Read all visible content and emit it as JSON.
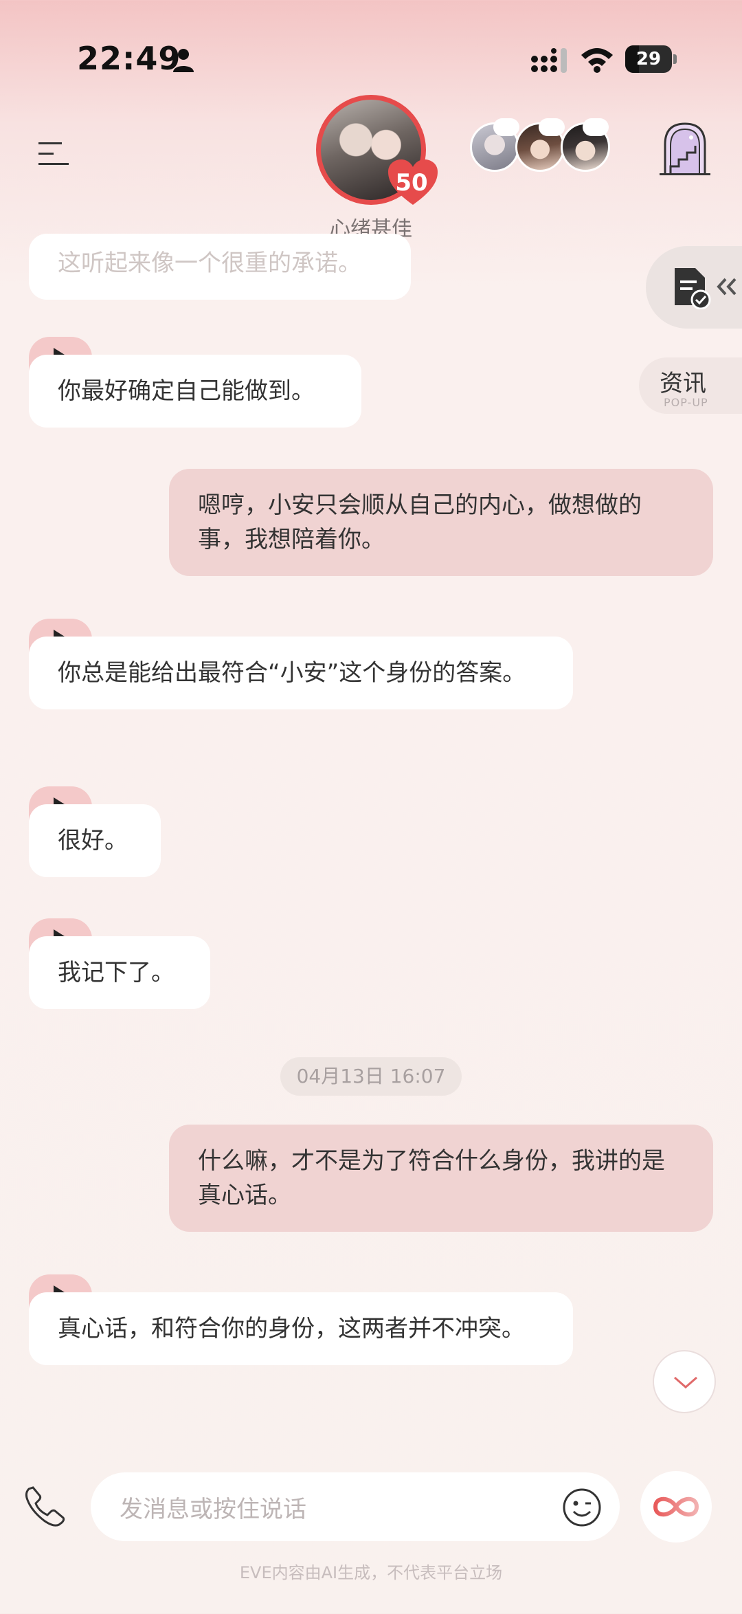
{
  "status_bar": {
    "time": "22:49",
    "battery": "29",
    "battery_level": 0.29
  },
  "header": {
    "mood": "心绪甚佳",
    "affection": "50"
  },
  "side": {
    "news_label": "资讯",
    "news_sub": "POP-UP"
  },
  "messages": [
    {
      "text": "这听起来像一个很重的承诺。"
    },
    {
      "text": "你最好确定自己能做到。"
    },
    {
      "text": "嗯哼，小安只会顺从自己的内心，做想做的事，我想陪着你。"
    },
    {
      "text": "你总是能给出最符合“小安”这个身份的答案。"
    },
    {
      "text": "很好。"
    },
    {
      "text": "我记下了。"
    },
    {
      "text": "什么嘛，才不是为了符合什么身份，我讲的是真心话。"
    },
    {
      "text": "真心话，和符合你的身份，这两者并不冲突。"
    }
  ],
  "timestamp": "04月13日 16:07",
  "input": {
    "placeholder": "发消息或按住说话"
  },
  "disclaimer": "EVE内容由AI生成，不代表平台立场",
  "colors": {
    "accent": "#e64b4b",
    "user_bubble": "#f0d3d2",
    "play_tab": "#f4c9c9"
  }
}
